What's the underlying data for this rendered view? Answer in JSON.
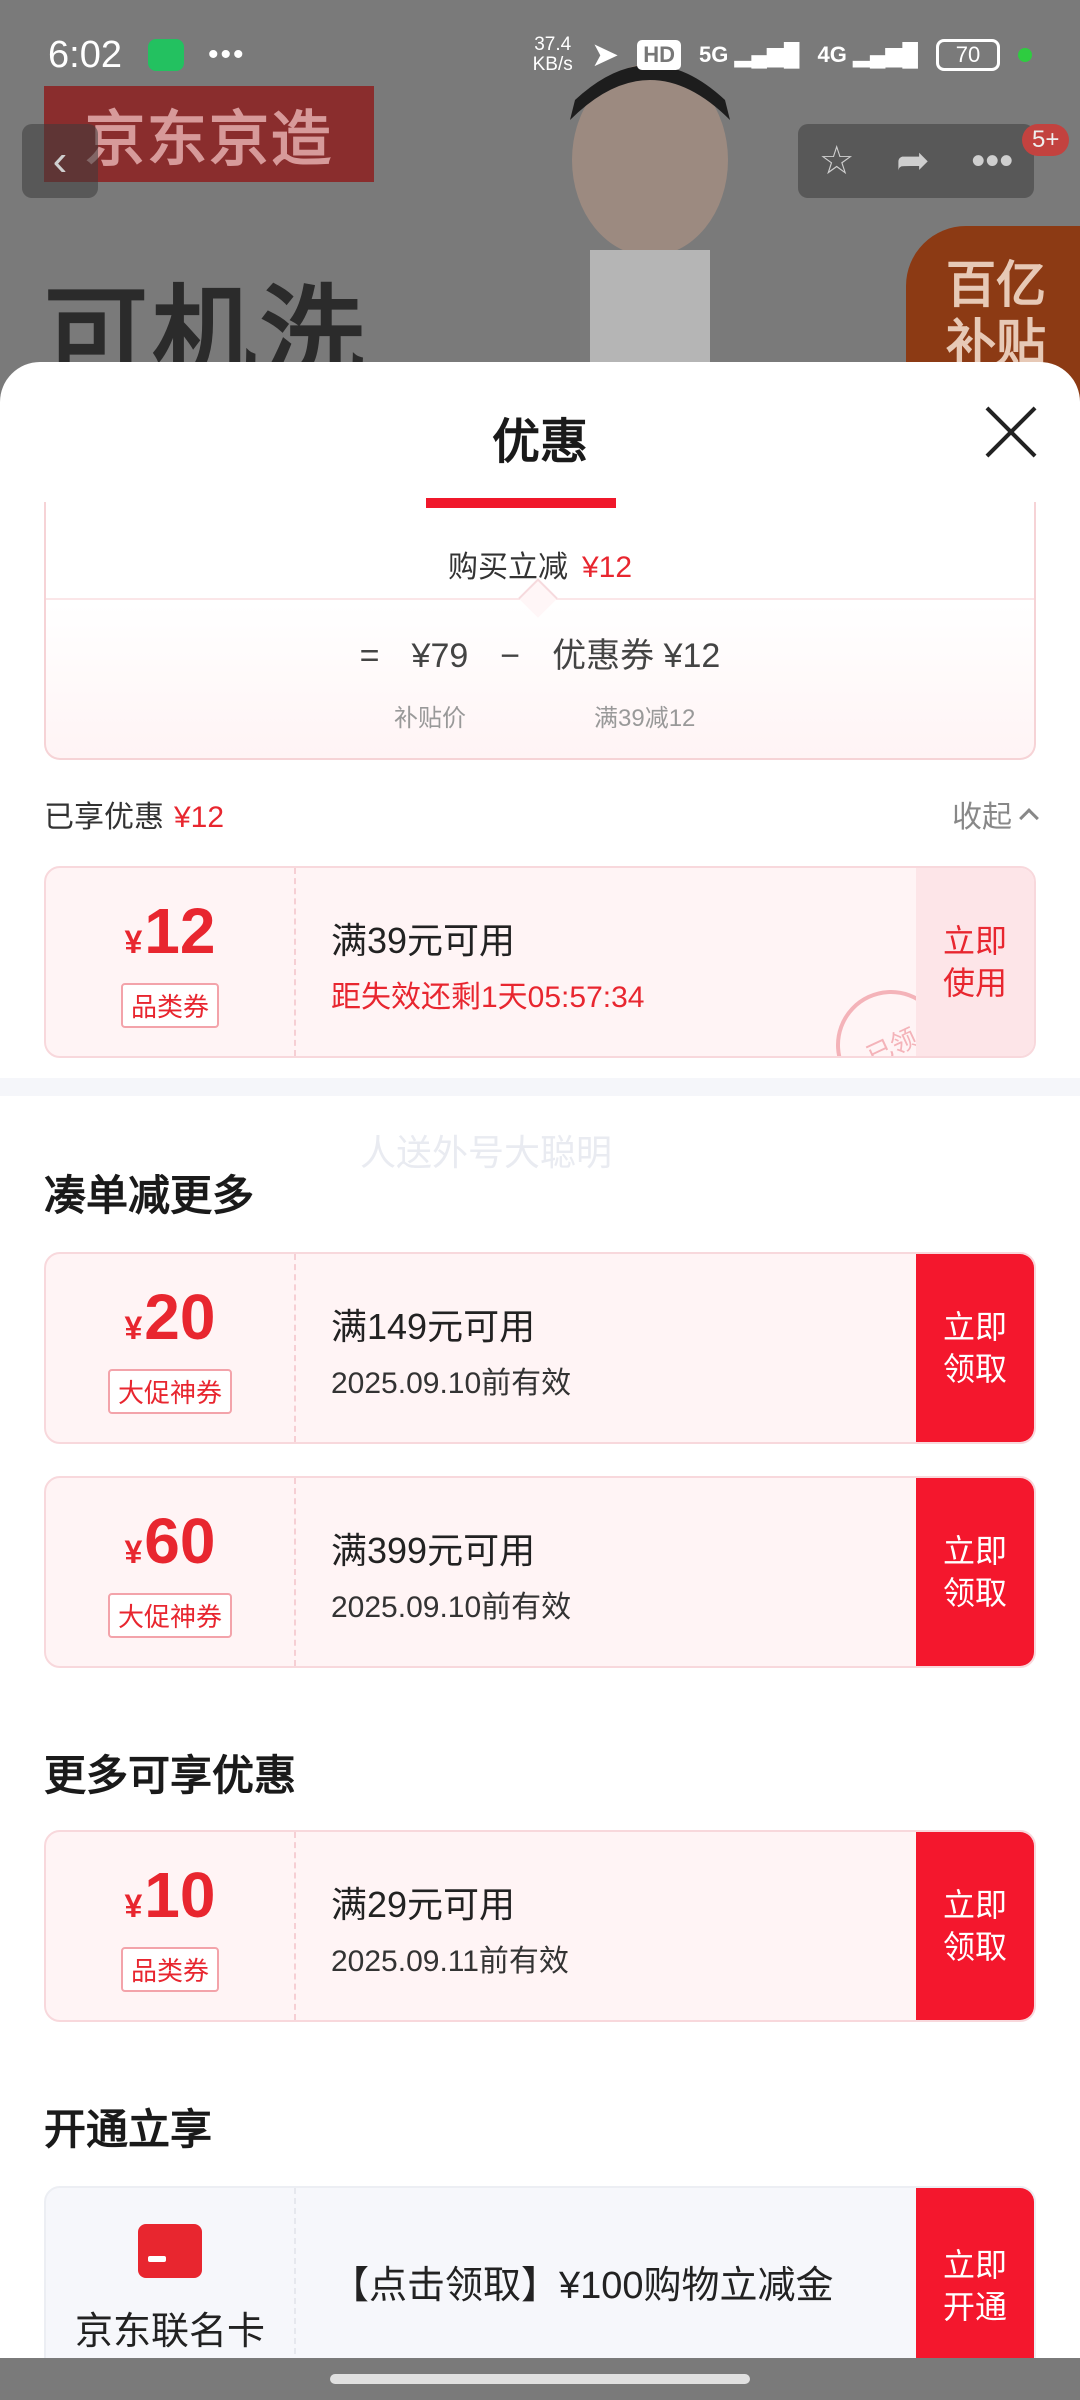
{
  "status_bar": {
    "time": "6:02",
    "dots": "•••",
    "speed_value": "37.4",
    "speed_unit": "KB/s",
    "hd": "HD",
    "net1": "5G",
    "net2": "4G",
    "battery": "70"
  },
  "background": {
    "brand": "京东京造",
    "headline": "可机洗",
    "badge_line1": "百亿",
    "badge_line2": "补贴",
    "cart_count": "5+"
  },
  "sheet": {
    "title": "优惠",
    "calc": {
      "cut_label": "购买立减",
      "cut_amount": "¥12",
      "equals": "=",
      "price": "¥79",
      "minus": "−",
      "coupon_label": "优惠券 ¥12",
      "price_sub": "补贴价",
      "coupon_sub": "满39减12"
    },
    "enjoyed_label": "已享优惠",
    "enjoyed_amount": "¥12",
    "collapse_label": "收起",
    "applied_coupon": {
      "currency": "¥",
      "amount": "12",
      "tag": "品类券",
      "condition": "满39元可用",
      "countdown": "距失效还剩1天05:57:34",
      "button": "立即使用",
      "stamp": "已领"
    },
    "watermark": "人送外号大聪明",
    "section_more": {
      "title": "凑单减更多",
      "coupons": [
        {
          "currency": "¥",
          "amount": "20",
          "tag": "大促神券",
          "condition": "满149元可用",
          "expiry": "2025.09.10前有效",
          "button": "立即领取"
        },
        {
          "currency": "¥",
          "amount": "60",
          "tag": "大促神券",
          "condition": "满399元可用",
          "expiry": "2025.09.10前有效",
          "button": "立即领取"
        }
      ]
    },
    "section_extra": {
      "title": "更多可享优惠",
      "coupons": [
        {
          "currency": "¥",
          "amount": "10",
          "tag": "品类券",
          "condition": "满29元可用",
          "expiry": "2025.09.11前有效",
          "button": "立即领取"
        }
      ]
    },
    "section_open": {
      "title": "开通立享",
      "card_name": "京东联名卡",
      "description": "【点击领取】¥100购物立减金",
      "button": "立即开通"
    }
  },
  "colors": {
    "accent_red": "#f4172d",
    "price_red": "#e8262f",
    "coupon_bg": "#fff4f5"
  }
}
